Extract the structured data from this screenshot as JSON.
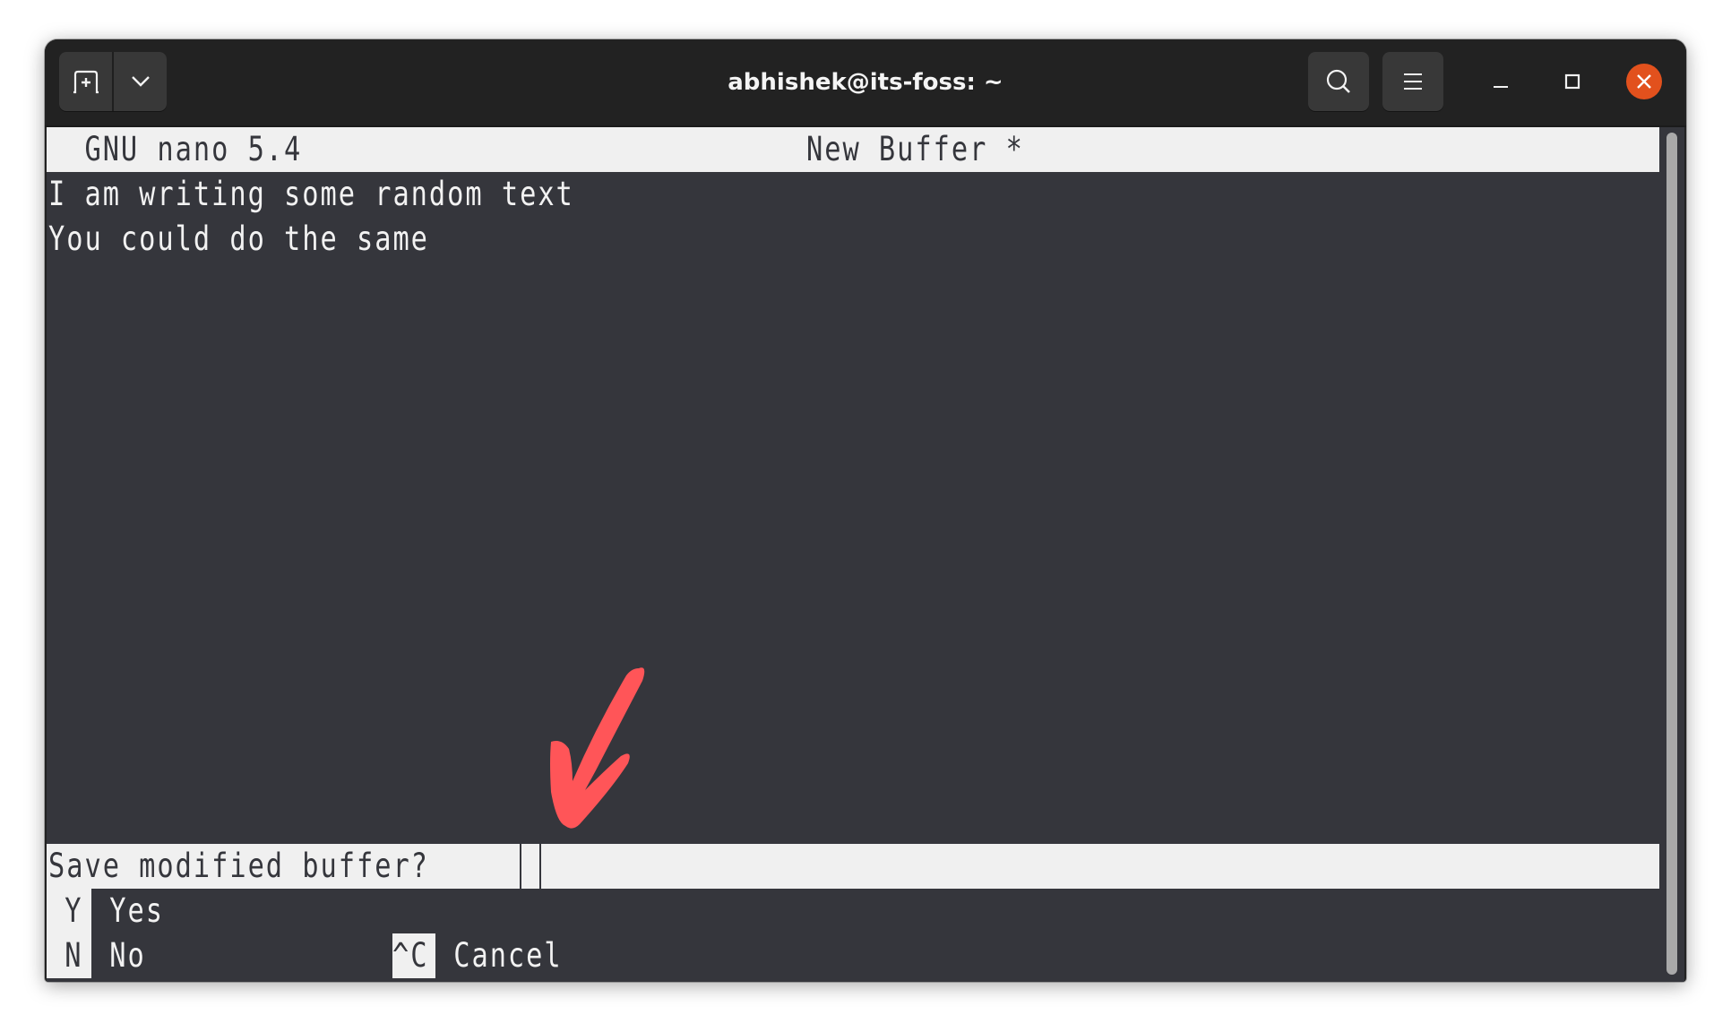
{
  "window": {
    "title": "abhishek@its-foss: ~",
    "header_buttons": {
      "new_tab_icon": "new-tab-icon",
      "dropdown_icon": "chevron-down-icon",
      "search_icon": "search-icon",
      "menu_icon": "hamburger-menu-icon",
      "minimize_icon": "minimize-icon",
      "maximize_icon": "maximize-icon",
      "close_icon": "close-icon"
    },
    "colors": {
      "headerbar": "#222222",
      "terminal_bg": "#35363c",
      "bar_bg": "#f0f0f0",
      "close_button": "#e2511d",
      "annotation_arrow": "#ff5558"
    }
  },
  "nano": {
    "version_label": "  GNU nano 5.4",
    "buffer_name": "New Buffer *",
    "lines": [
      "I am writing some random text",
      "You could do the same"
    ],
    "prompt": "Save modified buffer?",
    "shortcuts": [
      {
        "key": " Y",
        "label": " Yes"
      },
      {
        "key": " N",
        "label": " No"
      },
      {
        "key": "^C",
        "label": " Cancel"
      }
    ]
  },
  "annotation": {
    "type": "arrow",
    "points_to": "prompt-cursor"
  }
}
